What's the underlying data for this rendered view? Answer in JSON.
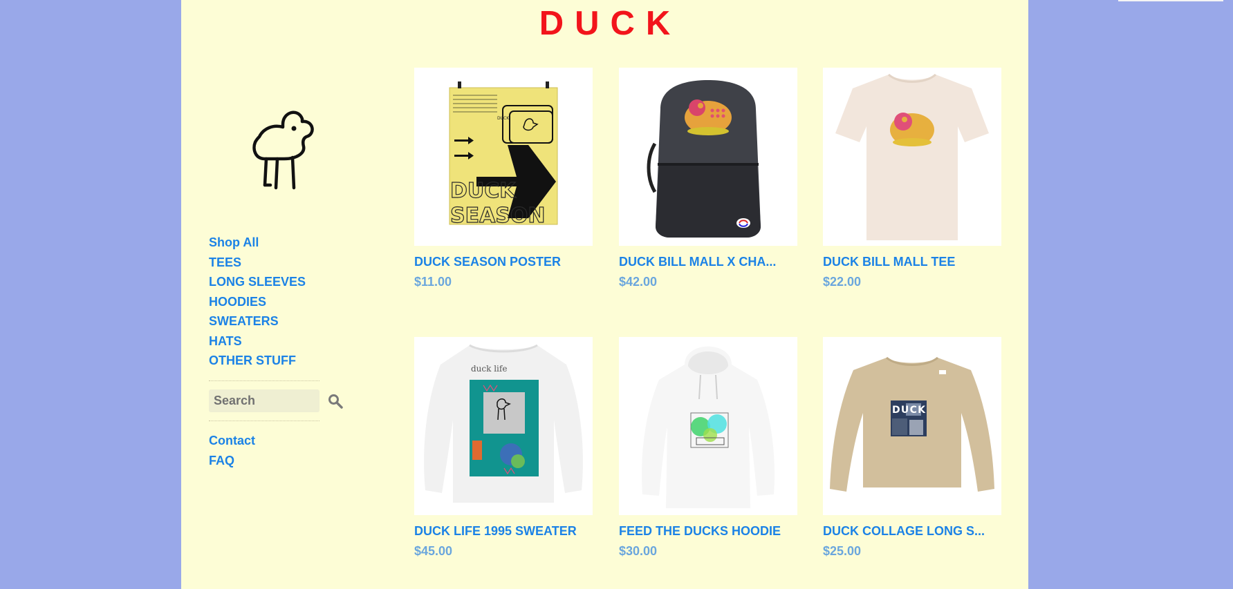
{
  "site": {
    "title": "DUCK"
  },
  "nav": {
    "items": [
      {
        "label": "Shop All"
      },
      {
        "label": "TEES"
      },
      {
        "label": "LONG SLEEVES"
      },
      {
        "label": "HOODIES"
      },
      {
        "label": "SWEATERS"
      },
      {
        "label": "HATS"
      },
      {
        "label": "OTHER STUFF"
      }
    ]
  },
  "search": {
    "placeholder": "Search",
    "icon": "magnifier-icon"
  },
  "footer_links": [
    {
      "label": "Contact"
    },
    {
      "label": "FAQ"
    }
  ],
  "products": [
    {
      "name": "DUCK SEASON POSTER",
      "price": "$11.00",
      "image": "poster"
    },
    {
      "name": "DUCK BILL MALL X CHA...",
      "price": "$42.00",
      "image": "backpack"
    },
    {
      "name": "DUCK BILL MALL TEE",
      "price": "$22.00",
      "image": "tee"
    },
    {
      "name": "DUCK LIFE 1995 SWEATER",
      "price": "$45.00",
      "image": "sweater"
    },
    {
      "name": "FEED THE DUCKS HOODIE",
      "price": "$30.00",
      "image": "hoodie"
    },
    {
      "name": "DUCK COLLAGE LONG S...",
      "price": "$25.00",
      "image": "longsleeve"
    }
  ],
  "product_images": {
    "poster": {
      "big_word_1": "DUCK",
      "big_word_2": "SEASON",
      "small_label": "DUCK"
    },
    "sweater": {
      "top_text": "duck life"
    },
    "longsleeve": {
      "letters": "DUCK"
    }
  },
  "colors": {
    "background": "#99a8e9",
    "page": "#fdfdd6",
    "title": "#f2141b",
    "link": "#1b82e6",
    "price": "#6aa6dd"
  }
}
